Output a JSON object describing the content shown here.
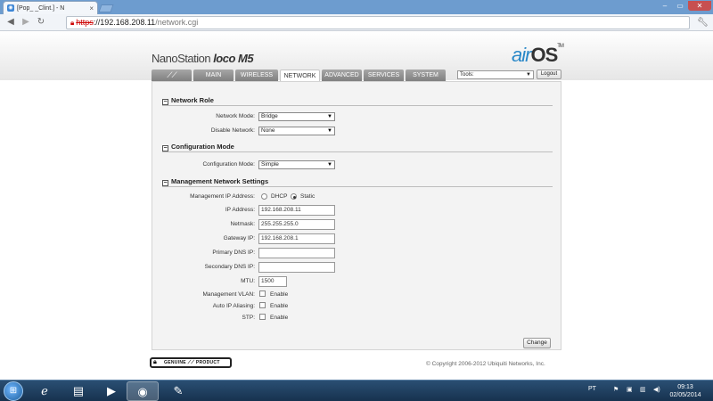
{
  "browser": {
    "tab_title": "[Pop_          _Clint.] - N",
    "tab_close": "×",
    "window_controls": {
      "minimize": "–",
      "maximize": "▭",
      "close": "✕"
    },
    "url_scheme": "https",
    "url_host": "://192.168.208.11",
    "url_path": "/network.cgi"
  },
  "header": {
    "product_name": "NanoStation",
    "product_suffix": "loco M5",
    "os_prefix": "air",
    "os_name": "OS",
    "os_tm": "TM"
  },
  "nav": {
    "tabs": [
      {
        "label": "MAIN"
      },
      {
        "label": "WIRELESS"
      },
      {
        "label": "NETWORK",
        "active": true
      },
      {
        "label": "ADVANCED"
      },
      {
        "label": "SERVICES"
      },
      {
        "label": "SYSTEM"
      }
    ],
    "tools_value": "Tools:",
    "logout_label": "Logout"
  },
  "network_role": {
    "title": "Network Role",
    "network_mode_label": "Network Mode:",
    "network_mode_value": "Bridge",
    "disable_network_label": "Disable Network:",
    "disable_network_value": "None"
  },
  "configuration_mode": {
    "title": "Configuration Mode",
    "config_mode_label": "Configuration Mode:",
    "config_mode_value": "Simple"
  },
  "management": {
    "title": "Management Network Settings",
    "ip_address_mode_label": "Management IP Address:",
    "dhcp_label": "DHCP",
    "static_label": "Static",
    "selected_mode": "Static",
    "ip_address_label": "IP Address:",
    "ip_address_value": "192.168.208.11",
    "netmask_label": "Netmask:",
    "netmask_value": "255.255.255.0",
    "gateway_label": "Gateway IP:",
    "gateway_value": "192.168.208.1",
    "primary_dns_label": "Primary DNS IP:",
    "primary_dns_value": "",
    "secondary_dns_label": "Secondary DNS IP:",
    "secondary_dns_value": "",
    "mtu_label": "MTU:",
    "mtu_value": "1500",
    "vlan_label": "Management VLAN:",
    "auto_ip_label": "Auto IP Aliasing:",
    "stp_label": "STP:",
    "enable_label": "Enable"
  },
  "actions": {
    "change_label": "Change"
  },
  "footer": {
    "genuine_label": "GENUINE ⟋⟋ PRODUCT",
    "copyright": "© Copyright 2006-2012 Ubiquiti Networks, Inc."
  },
  "taskbar": {
    "language": "PT",
    "time": "09:13",
    "date": "02/05/2014"
  },
  "colors": {
    "accent_air": "#2a88c8",
    "nav_tab": "#8e8e8e",
    "taskbar": "#1f3f60"
  }
}
